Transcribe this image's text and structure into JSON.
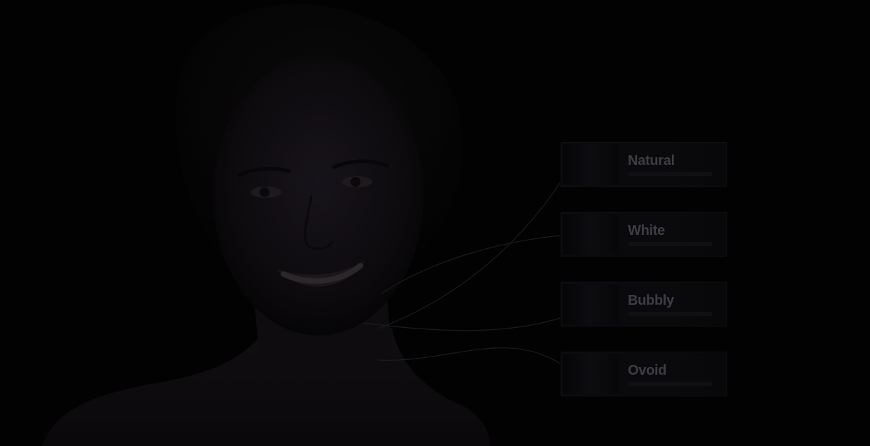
{
  "options": [
    {
      "label": "Natural"
    },
    {
      "label": "White"
    },
    {
      "label": "Bubbly"
    },
    {
      "label": "Ovoid"
    }
  ],
  "colors": {
    "background": "#020203",
    "card_title": "#3d3d46",
    "connector_line": "#1c1c22"
  }
}
